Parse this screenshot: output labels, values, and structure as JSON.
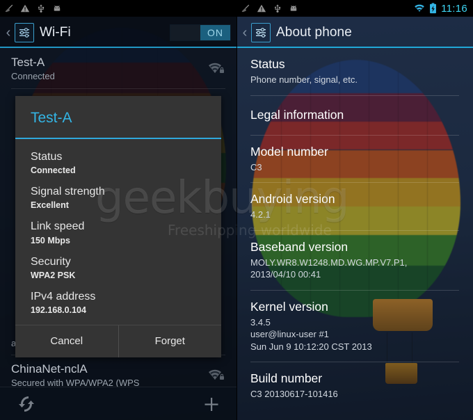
{
  "left": {
    "statusbar": {
      "icons": [
        "sd-card-icon",
        "warning-icon",
        "usb-icon",
        "android-robot-icon"
      ]
    },
    "actionbar": {
      "back_label": "‹",
      "app_icon": "settings-sliders-icon",
      "title": "Wi-Fi",
      "switch_label": "ON"
    },
    "networks": [
      {
        "ssid": "Test-A",
        "sub": "Connected",
        "icon": "wifi-secured-icon"
      },
      {
        "ssid": "",
        "sub": "available)",
        "icon": ""
      },
      {
        "ssid": "ChinaNet-nclA",
        "sub": "Secured with WPA/WPA2 (WPS",
        "icon": "wifi-secured-icon"
      }
    ],
    "dialog": {
      "title": "Test-A",
      "items": [
        {
          "label": "Status",
          "value": "Connected"
        },
        {
          "label": "Signal strength",
          "value": "Excellent"
        },
        {
          "label": "Link speed",
          "value": "150 Mbps"
        },
        {
          "label": "Security",
          "value": "WPA2 PSK"
        },
        {
          "label": "IPv4 address",
          "value": "192.168.0.104"
        }
      ],
      "cancel_label": "Cancel",
      "forget_label": "Forget"
    },
    "bottombar": {
      "scan_icon": "refresh-scan-icon",
      "add_icon": "plus-icon"
    }
  },
  "right": {
    "statusbar": {
      "icons": [
        "sd-card-icon",
        "warning-icon",
        "usb-icon",
        "android-robot-icon"
      ],
      "wifi_icon": "wifi-icon",
      "battery_icon": "battery-charging-icon",
      "clock": "11:16"
    },
    "actionbar": {
      "back_label": "‹",
      "app_icon": "settings-sliders-icon",
      "title": "About phone"
    },
    "items": [
      {
        "title": "Status",
        "sub": "Phone number, signal, etc."
      },
      {
        "title": "Legal information",
        "sub": ""
      },
      {
        "title": "Model number",
        "sub": "C3"
      },
      {
        "title": "Android version",
        "sub": "4.2.1"
      },
      {
        "title": "Baseband version",
        "sub": "MOLY.WR8.W1248.MD.WG.MP.V7.P1,\n2013/04/10 00:41"
      },
      {
        "title": "Kernel version",
        "sub": "3.4.5\nuser@linux-user #1\nSun Jun 9 10:12:20 CST 2013"
      },
      {
        "title": "Build number",
        "sub": "C3 20130617-101416"
      }
    ]
  },
  "watermark": {
    "brand": "geekbuying",
    "tagline": "Freeshipping worldwide"
  },
  "colors": {
    "accent_cyan": "#33b5e5",
    "clock_cyan": "#3dd5f3",
    "switch_on": "#1b607f",
    "dialog_bg": "#343434"
  }
}
